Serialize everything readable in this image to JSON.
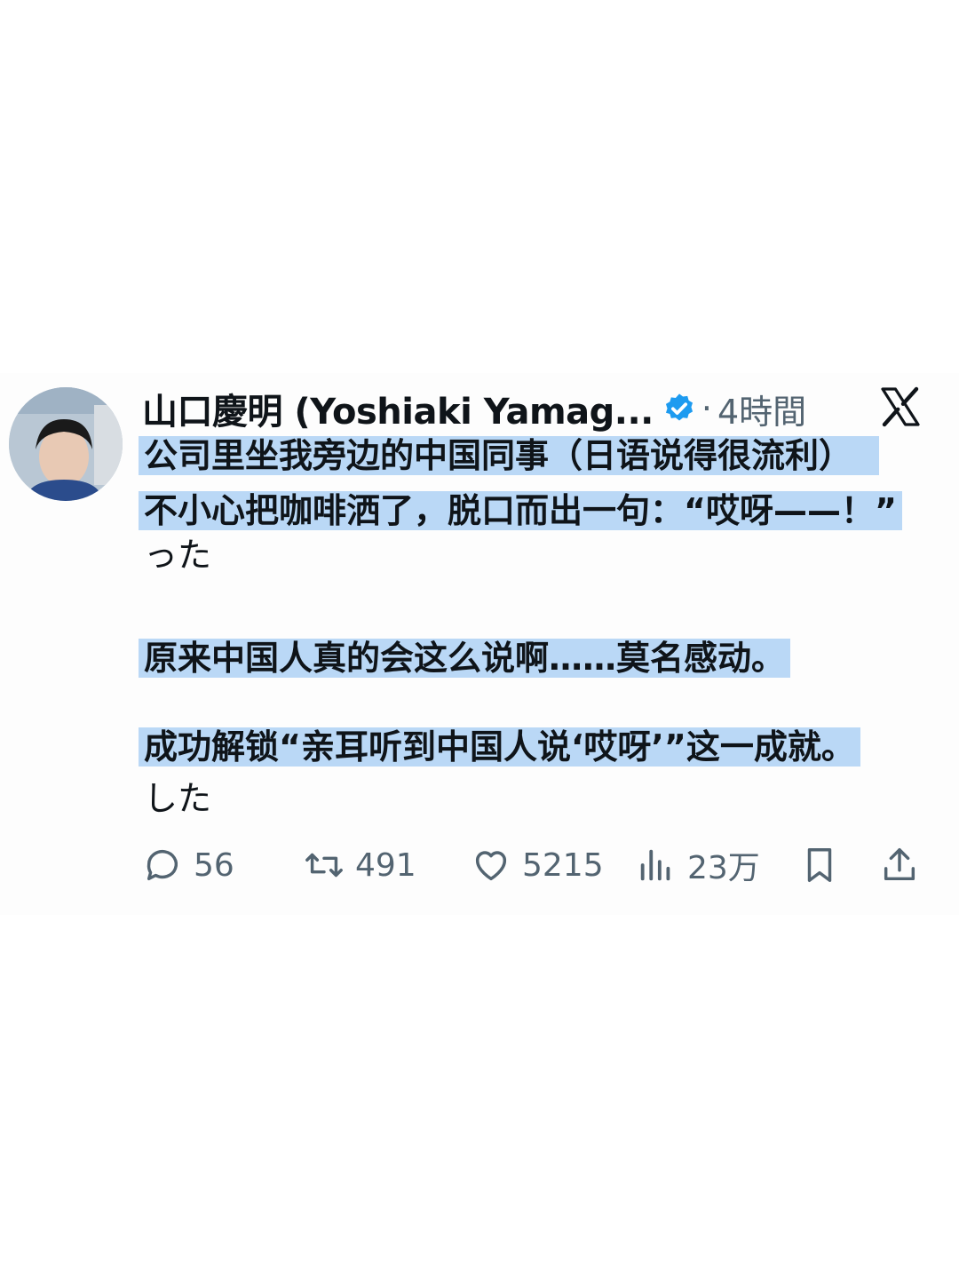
{
  "post": {
    "author_name": "山口慶明 (Yoshiaki Yamag...",
    "separator": "·",
    "time": "4時間",
    "lines": [
      "公司里坐我旁边的中国同事（日语说得很流利）",
      "不小心把咖啡洒了，脱口而出一句：“哎呀——！”",
      "った",
      "原来中国人真的会这么说啊……莫名感动。",
      "成功解锁“亲耳听到中国人说‘哎呀’”这一成就。",
      "した"
    ]
  },
  "actions": {
    "replies": "56",
    "reposts": "491",
    "likes": "5215",
    "views": "23万"
  },
  "colors": {
    "highlight": "#78b4f0",
    "verified": "#1d9bf0",
    "meta": "#536471",
    "text": "#0f1419"
  },
  "icons": [
    "verified-badge-icon",
    "x-logo-icon",
    "reply-icon",
    "repost-icon",
    "like-icon",
    "views-icon",
    "bookmark-icon",
    "share-icon"
  ]
}
